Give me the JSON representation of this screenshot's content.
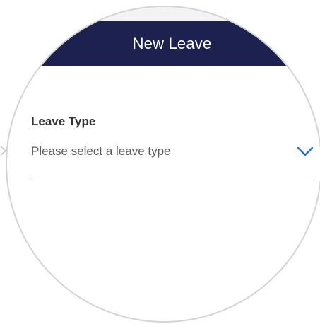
{
  "header": {
    "title": "New Leave",
    "background": "#1d2150",
    "text_color": "#ffffff"
  },
  "form": {
    "leave_type": {
      "label": "Leave Type",
      "placeholder": "Please select a leave type",
      "dropdown_icon": "chevron-down-icon",
      "accent": "#1f6fd1"
    }
  },
  "decor": {
    "callout_arrow_icon": "chevron-right-icon"
  }
}
